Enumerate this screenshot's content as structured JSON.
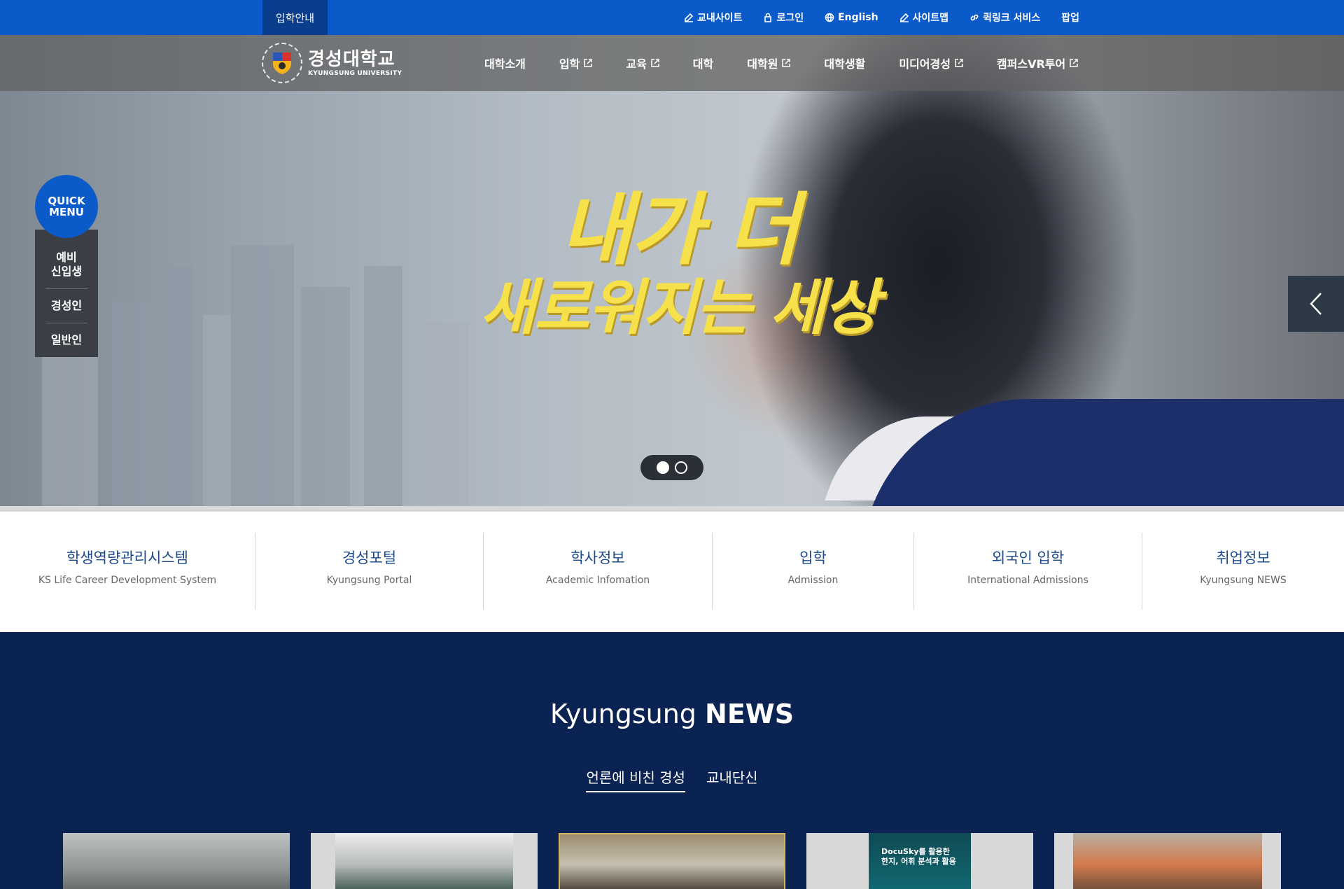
{
  "topbar": {
    "admission_tab": "입학안내",
    "links": [
      {
        "label": "교내사이트",
        "icon": "edit-icon"
      },
      {
        "label": "로그인",
        "icon": "lock-icon"
      },
      {
        "label": "English",
        "icon": "globe-icon"
      },
      {
        "label": "사이트맵",
        "icon": "edit-icon"
      },
      {
        "label": "퀵링크 서비스",
        "icon": "link-icon"
      },
      {
        "label": "팝업",
        "icon": ""
      }
    ]
  },
  "logo": {
    "name_ko": "경성대학교",
    "name_en": "KYUNGSUNG UNIVERSITY"
  },
  "nav": {
    "items": [
      {
        "label": "대학소개",
        "external": false
      },
      {
        "label": "입학",
        "external": true
      },
      {
        "label": "교육",
        "external": true
      },
      {
        "label": "대학",
        "external": false
      },
      {
        "label": "대학원",
        "external": true
      },
      {
        "label": "대학생활",
        "external": false
      },
      {
        "label": "미디어경성",
        "external": true
      },
      {
        "label": "캠퍼스VR투어",
        "external": true
      }
    ]
  },
  "hero": {
    "slogan_line1": "내가 더",
    "slogan_line2": "새로워지는 세상",
    "slides_total": 2,
    "active_slide": 1
  },
  "quick_menu": {
    "button_line1": "QUICK",
    "button_line2": "MENU",
    "items": [
      {
        "line1": "예비",
        "line2": "신입생"
      },
      {
        "line1": "경성인",
        "line2": ""
      },
      {
        "line1": "일반인",
        "line2": ""
      }
    ]
  },
  "services": [
    {
      "ko": "학생역량관리시스템",
      "en": "KS Life Career Development System"
    },
    {
      "ko": "경성포털",
      "en": "Kyungsung Portal"
    },
    {
      "ko": "학사정보",
      "en": "Academic Infomation"
    },
    {
      "ko": "입학",
      "en": "Admission"
    },
    {
      "ko": "외국인 입학",
      "en": "International Admissions"
    },
    {
      "ko": "취업정보",
      "en": "Kyungsung NEWS"
    }
  ],
  "news": {
    "title_light": "Kyungsung",
    "title_bold": "NEWS",
    "tabs": [
      "언론에 비친 경성",
      "교내단신"
    ],
    "active_tab": 0,
    "card4_text_line1": "DocuSky를 활용한",
    "card4_text_line2": "한지, 어휘 분석과 활용"
  },
  "colors": {
    "topbar": "#0a5bc9",
    "admission_tab": "#0a3e8c",
    "news_bg": "#0b2353",
    "service_text": "#1d4a8c",
    "slogan": "#f6e14a"
  }
}
